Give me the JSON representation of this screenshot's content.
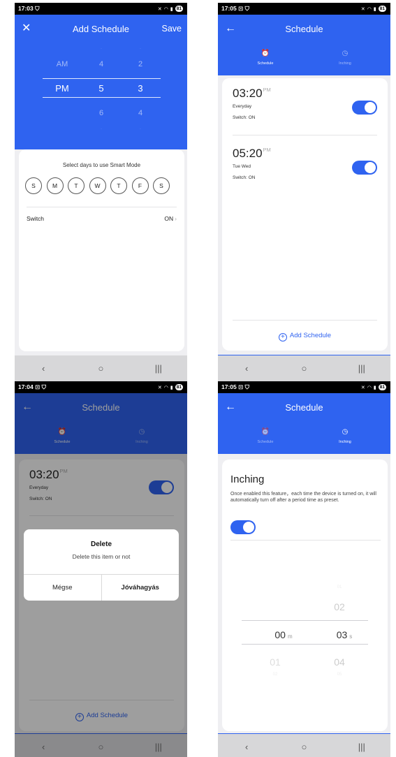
{
  "status": {
    "p1_time": "17:03",
    "p2_time": "17:05",
    "p3_time": "17:04",
    "p4_time": "17:05",
    "battery": "81"
  },
  "add_schedule": {
    "title": "Add Schedule",
    "save_label": "Save",
    "picker": {
      "ampm": [
        "AM",
        "PM"
      ],
      "hours": [
        "4",
        "5",
        "6"
      ],
      "minutes": [
        "2",
        "3",
        "4"
      ],
      "selected": {
        "ampm": "PM",
        "hour": "5",
        "minute": "3"
      }
    },
    "days_title": "Select days to use Smart Mode",
    "days": [
      "S",
      "M",
      "T",
      "W",
      "T",
      "F",
      "S"
    ],
    "switch_label": "Switch",
    "switch_value": "ON"
  },
  "schedule": {
    "title": "Schedule",
    "tabs": [
      {
        "label": "Schedule",
        "icon": "alarm-clock-icon"
      },
      {
        "label": "Inching",
        "icon": "clock-icon"
      }
    ],
    "items": [
      {
        "time": "03:20",
        "ampm": "PM",
        "days": "Everyday",
        "switch": "Switch: ON",
        "enabled": true
      },
      {
        "time": "05:20",
        "ampm": "PM",
        "days": "Tue Wed",
        "switch": "Switch: ON",
        "enabled": true
      }
    ],
    "add_label": "Add Schedule"
  },
  "delete_dialog": {
    "title": "Delete",
    "message": "Delete this item or not",
    "cancel": "Mégse",
    "confirm": "Jóváhagyás"
  },
  "inching": {
    "title": "Inching",
    "description": "Once enabled this feature，each time the device is turned on, it will automatically turn off after a period time as preset.",
    "enabled": true,
    "picker": {
      "minutes": [
        "00",
        "01"
      ],
      "seconds": [
        "02",
        "03",
        "04"
      ],
      "selected_minute": "00",
      "selected_second": "03",
      "minute_unit": "m",
      "second_unit": "s"
    }
  },
  "colors": {
    "primary": "#2f63f0",
    "navbar": "#d7d7d9"
  }
}
